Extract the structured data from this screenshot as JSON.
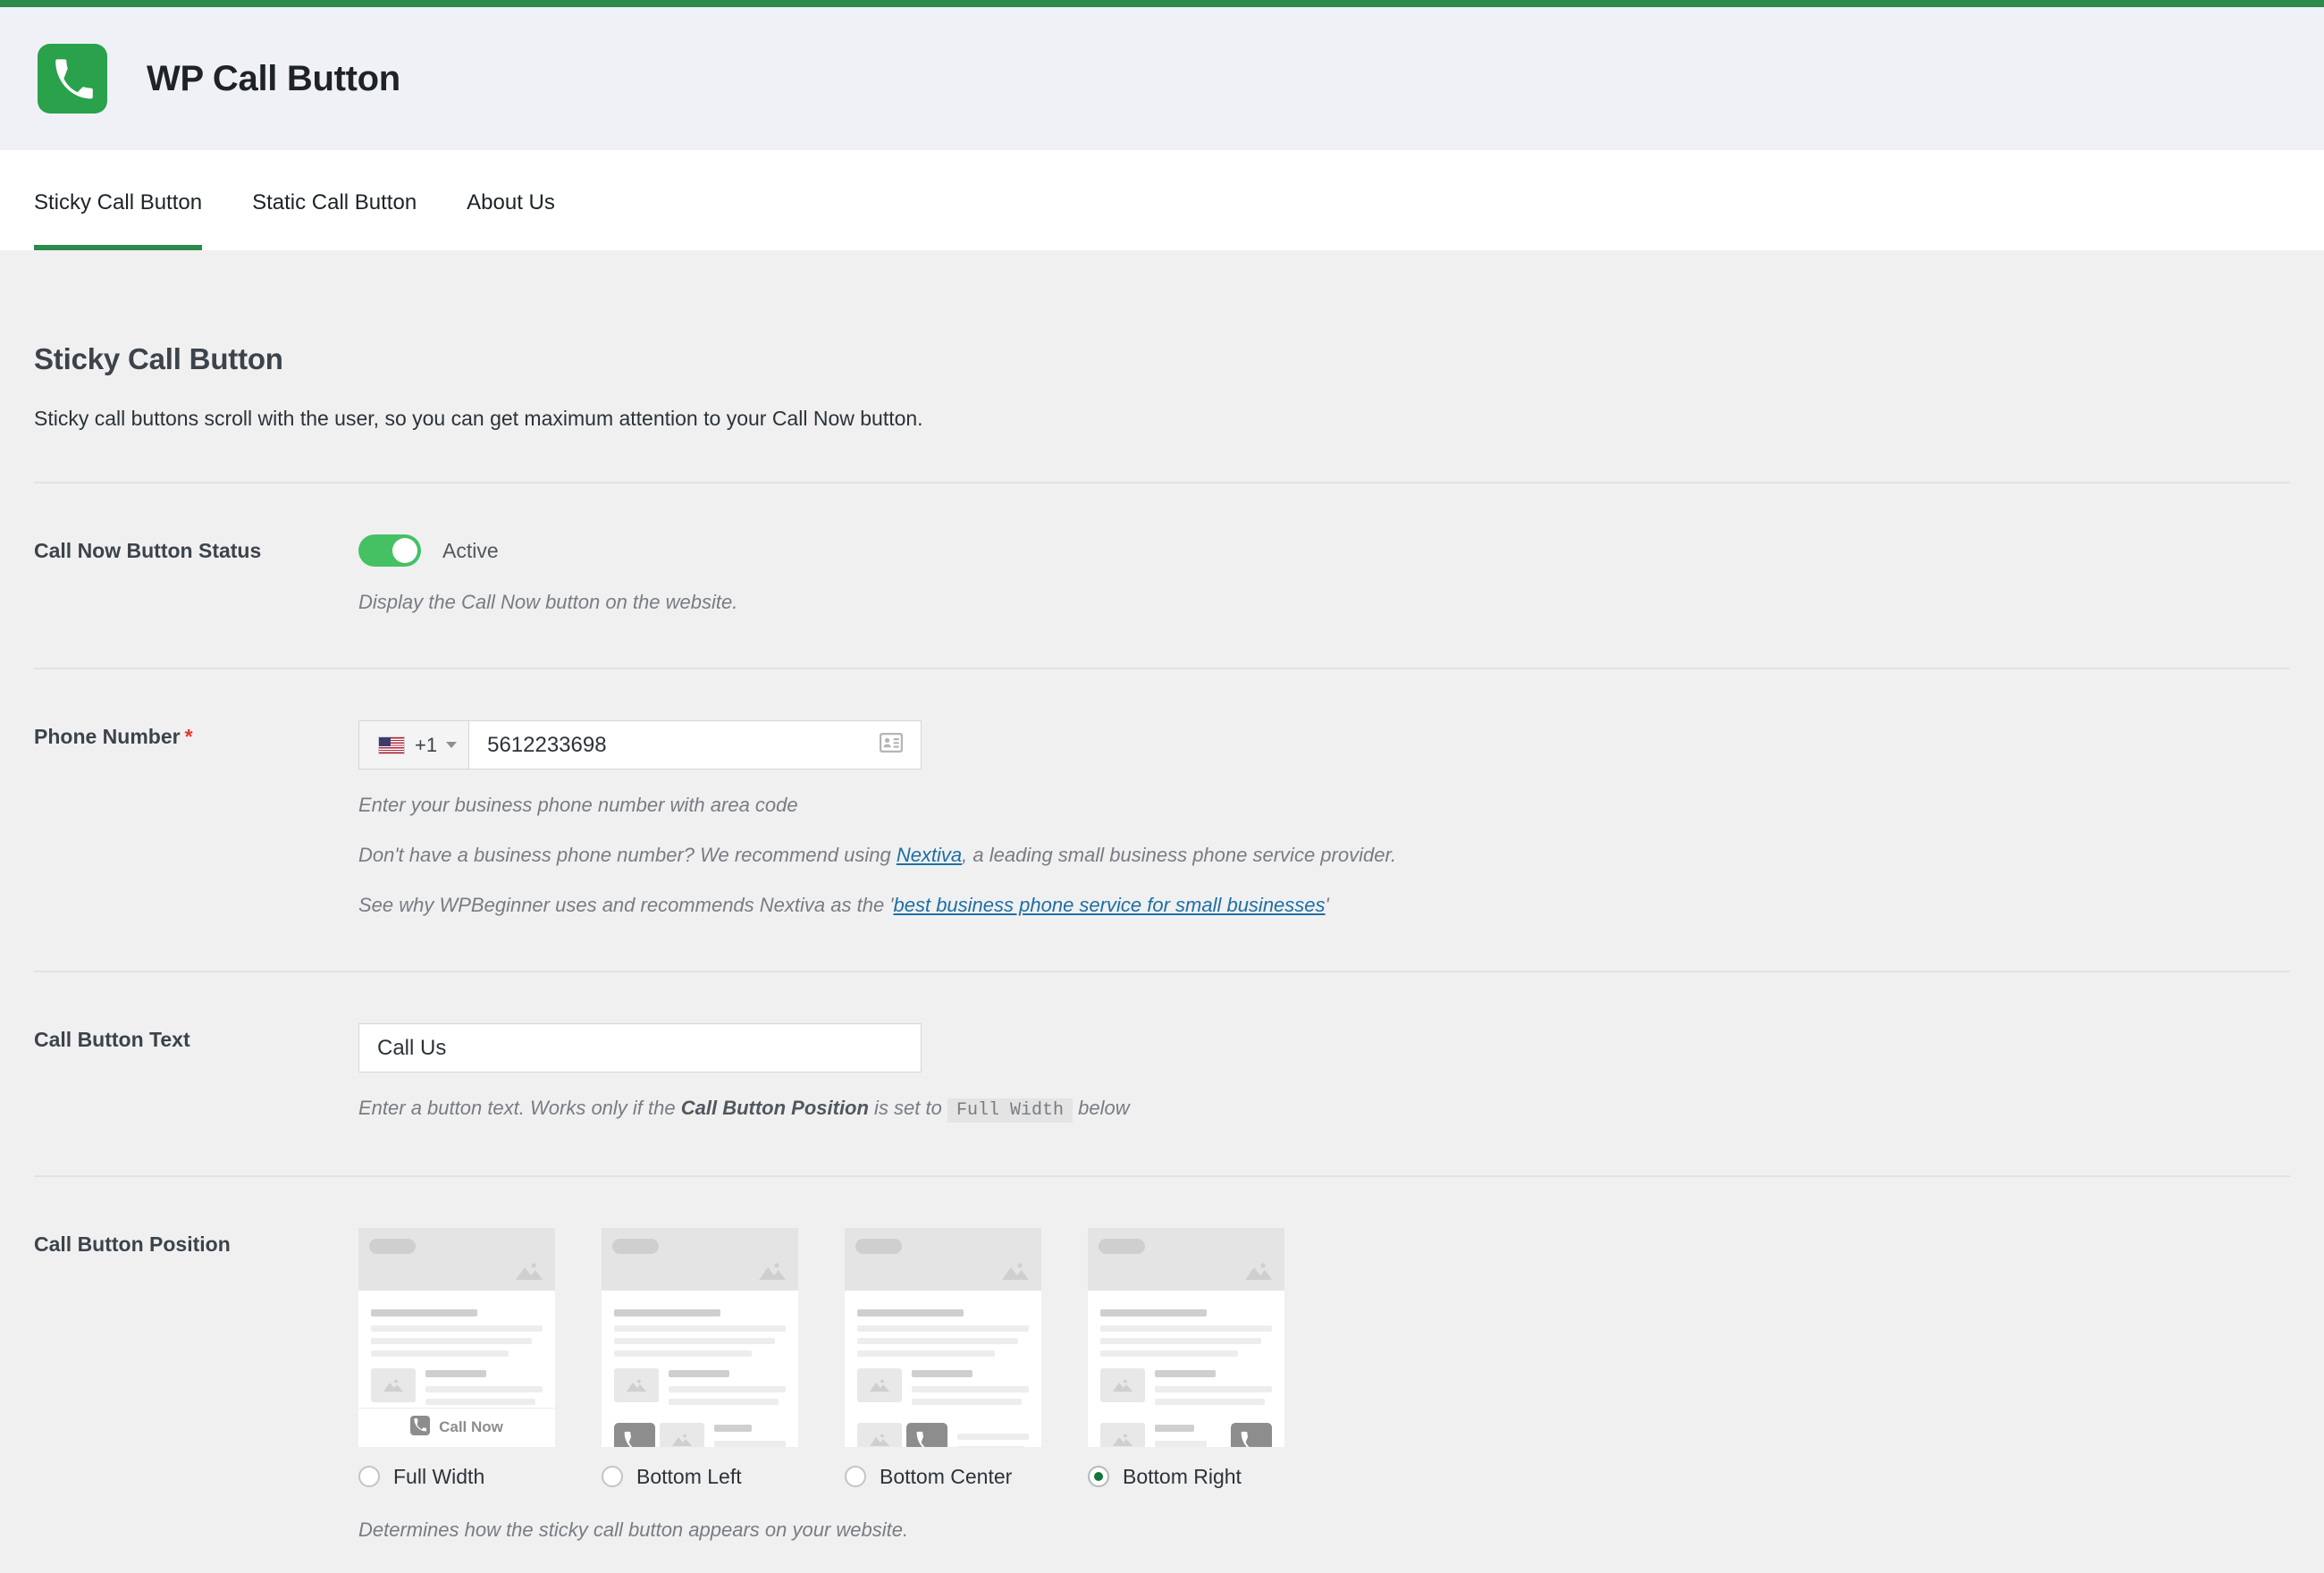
{
  "theme": {
    "accent_green": "#2c8a4b",
    "toggle_green": "#45c163",
    "link_blue": "#1d6fa3",
    "required_red": "#e8352b",
    "page_bg": "#f0f0f1",
    "header_bg": "#eff1f6"
  },
  "header": {
    "logo_icon": "phone-handset-icon",
    "title": "WP Call Button"
  },
  "tabs": [
    {
      "label": "Sticky Call Button",
      "active": true
    },
    {
      "label": "Static Call Button",
      "active": false
    },
    {
      "label": "About Us",
      "active": false
    }
  ],
  "page": {
    "title": "Sticky Call Button",
    "subtitle": "Sticky call buttons scroll with the user, so you can get maximum attention to your Call Now button."
  },
  "status_row": {
    "label": "Call Now Button Status",
    "toggle_on": true,
    "toggle_state_text": "Active",
    "help": "Display the Call Now button on the website."
  },
  "phone_row": {
    "label": "Phone Number",
    "required_mark": "*",
    "country_flag": "us-flag-icon",
    "country_code": "+1",
    "value": "5612233698",
    "placeholder": "",
    "contact_icon": "contact-card-icon",
    "help1": "Enter your business phone number with area code",
    "help2_a": "Don't have a business phone number? We recommend using ",
    "help2_link": "Nextiva",
    "help2_b": ", a leading small business phone service provider.",
    "help3_a": "See why WPBeginner uses and recommends Nextiva as the '",
    "help3_link": "best business phone service for small businesses",
    "help3_b": "'"
  },
  "button_text_row": {
    "label": "Call Button Text",
    "value": "Call Us",
    "placeholder": "",
    "help_a": "Enter a button text. Works only if the ",
    "help_bold": "Call Button Position",
    "help_b": " is set to ",
    "help_code": "Full Width",
    "help_c": " below"
  },
  "position_row": {
    "label": "Call Button Position",
    "help": "Determines how the sticky call button appears on your website.",
    "options": [
      {
        "label": "Full Width",
        "value": "full-width",
        "selected": false
      },
      {
        "label": "Bottom Left",
        "value": "bottom-left",
        "selected": false
      },
      {
        "label": "Bottom Center",
        "value": "bottom-center",
        "selected": false
      },
      {
        "label": "Bottom Right",
        "value": "bottom-right",
        "selected": true
      }
    ],
    "preview_call_now_label": "Call Now"
  }
}
